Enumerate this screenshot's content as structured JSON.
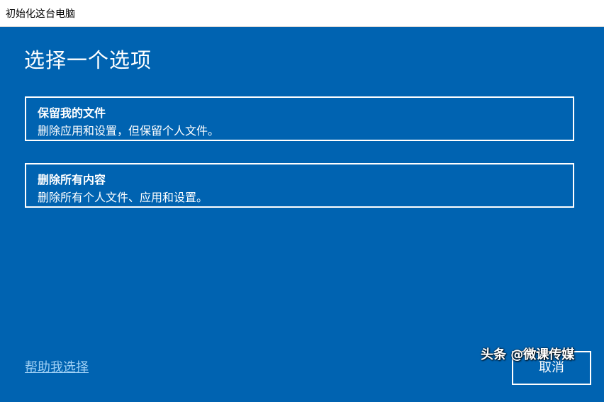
{
  "window": {
    "title": "初始化这台电脑"
  },
  "main": {
    "heading": "选择一个选项",
    "options": [
      {
        "title": "保留我的文件",
        "description": "删除应用和设置，但保留个人文件。"
      },
      {
        "title": "删除所有内容",
        "description": "删除所有个人文件、应用和设置。"
      }
    ]
  },
  "footer": {
    "help_link": "帮助我选择",
    "cancel_label": "取消"
  },
  "watermark": "头条 @微课传媒",
  "colors": {
    "background": "#0063b1",
    "text": "#ffffff",
    "link": "#9fd0f5"
  }
}
